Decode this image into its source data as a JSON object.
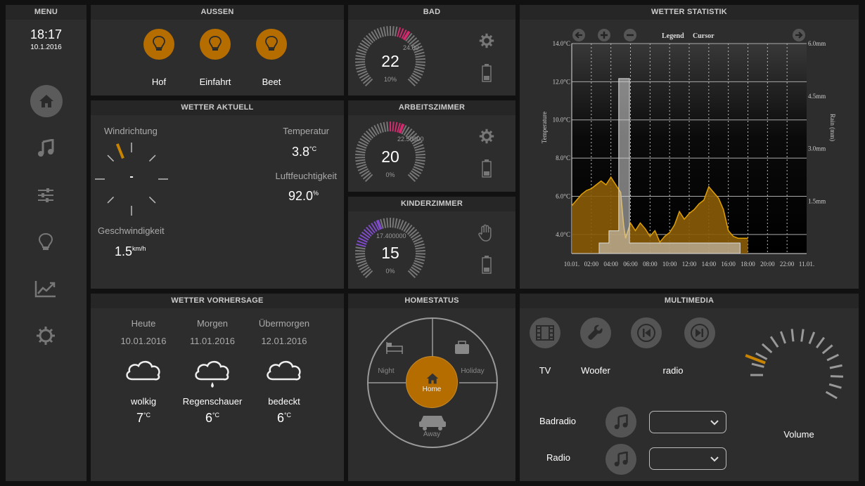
{
  "menu": {
    "title": "MENU",
    "time": "18:17",
    "date": "10.1.2016"
  },
  "aussen": {
    "title": "AUSSEN",
    "lights": [
      {
        "label": "Hof"
      },
      {
        "label": "Einfahrt"
      },
      {
        "label": "Beet"
      }
    ]
  },
  "rooms": [
    {
      "title": "BAD",
      "current": "22",
      "setpoint": "24.00",
      "valve": "10%",
      "setpoint_fraction": 0.62,
      "current_fraction": 0.55,
      "color": "#d12a6e"
    },
    {
      "title": "ARBEITSZIMMER",
      "current": "20",
      "setpoint": "22.50000",
      "valve": "0%",
      "setpoint_fraction": 0.58,
      "current_fraction": 0.5,
      "color": "#d12a6e"
    },
    {
      "title": "KINDERZIMMER",
      "current": "15",
      "setpoint": "17.400000",
      "valve": "0%",
      "setpoint_fraction": 0.42,
      "current_fraction": 0.22,
      "color": "#7e4bc9"
    }
  ],
  "wetter_aktuell": {
    "title": "WETTER AKTUELL",
    "wind_label": "Windrichtung",
    "wind_center": "-",
    "speed_label": "Geschwindigkeit",
    "speed_value": "1.5",
    "speed_unit": "km/h",
    "temp_label": "Temperatur",
    "temp_value": "3.8",
    "temp_unit": "°C",
    "hum_label": "Luftfeuchtigkeit",
    "hum_value": "92.0",
    "hum_unit": "%"
  },
  "forecast": {
    "title": "WETTER VORHERSAGE",
    "days": [
      {
        "day": "Heute",
        "date": "10.01.2016",
        "desc": "wolkig",
        "temp": "7",
        "unit": "°C"
      },
      {
        "day": "Morgen",
        "date": "11.01.2016",
        "desc": "Regenschauer",
        "temp": "6",
        "unit": "°C"
      },
      {
        "day": "Übermorgen",
        "date": "12.01.2016",
        "desc": "bedeckt",
        "temp": "6",
        "unit": "°C"
      }
    ]
  },
  "homestatus": {
    "title": "HOMESTATUS",
    "night": "Night",
    "holiday": "Holiday",
    "home": "Home",
    "away": "Away"
  },
  "multimedia": {
    "title": "MULTIMEDIA",
    "buttons": [
      {
        "label": "TV"
      },
      {
        "label": "Woofer"
      },
      {
        "label": ""
      },
      {
        "label": "radio"
      }
    ],
    "volume_label": "Volume",
    "volume_fraction": 0.1,
    "players": [
      {
        "label": "Badradio"
      },
      {
        "label": "Radio"
      }
    ]
  },
  "chart_data": {
    "type": "area",
    "title": "WETTER STATISTIK",
    "controls": {
      "legend": "Legend",
      "cursor": "Cursor"
    },
    "ylabel": "Temperature",
    "y2label": "Rain (mm)",
    "ylim": [
      3.0,
      14.0
    ],
    "y2lim": [
      0,
      6.0
    ],
    "yticks": [
      "4.0°C",
      "6.0°C",
      "8.0°C",
      "10.0°C",
      "12.0°C",
      "14.0°C"
    ],
    "y2ticks": [
      "1.5mm",
      "3.0mm",
      "4.5mm",
      "6.0mm"
    ],
    "xticks": [
      "10.01.",
      "02:00",
      "04:00",
      "06:00",
      "08:00",
      "10:00",
      "12:00",
      "14:00",
      "16:00",
      "18:00",
      "20:00",
      "22:00",
      "11.01."
    ],
    "series": [
      {
        "name": "Temperature",
        "color": "#c88400",
        "x_hours": [
          0,
          0.5,
          1,
          1.5,
          2,
          2.5,
          3,
          3.5,
          4,
          4.5,
          5,
          5.3,
          5.5,
          6,
          6.5,
          7,
          7.5,
          8,
          8.5,
          9,
          9.5,
          10,
          10.5,
          11,
          11.5,
          12,
          12.5,
          13,
          13.5,
          14,
          14.5,
          15,
          15.5,
          16,
          16.5,
          17,
          17.5,
          18
        ],
        "values": [
          5.5,
          5.8,
          6.1,
          6.3,
          6.4,
          6.6,
          6.8,
          6.6,
          7.0,
          6.6,
          6.2,
          4.5,
          3.8,
          4.6,
          4.2,
          4.6,
          4.3,
          3.9,
          4.2,
          3.6,
          3.9,
          4.1,
          4.5,
          5.2,
          4.8,
          5.1,
          5.3,
          5.6,
          5.8,
          6.5,
          6.2,
          5.9,
          5.3,
          4.2,
          3.9,
          3.8,
          3.8,
          3.8
        ]
      },
      {
        "name": "Rain",
        "color": "#cccccc",
        "x_hours": [
          0,
          2.8,
          2.8,
          3.8,
          3.8,
          4.8,
          4.8,
          5.9,
          5.9,
          8.0,
          16.0,
          16.0,
          17.2,
          17.2
        ],
        "values": [
          0,
          0,
          0.3,
          0.3,
          0.65,
          0.65,
          5.0,
          5.0,
          0.3,
          0.3,
          0.3,
          0.3,
          0.3,
          0
        ]
      }
    ]
  },
  "colors": {
    "accent": "#b56d00",
    "panel": "#2d2d2d",
    "title": "#262626"
  }
}
